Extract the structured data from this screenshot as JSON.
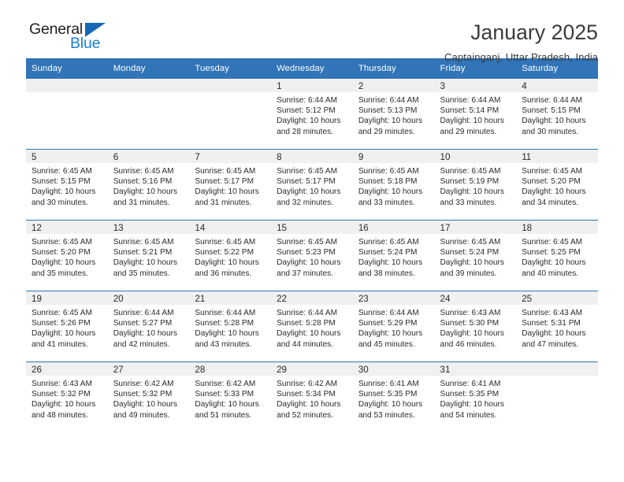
{
  "brand": {
    "name_top": "General",
    "name_bottom": "Blue",
    "triangle_color": "#1668b3",
    "blue_color": "#1c7fd4"
  },
  "header": {
    "title": "January 2025",
    "subtitle": "Captainganj, Uttar Pradesh, India"
  },
  "theme": {
    "header_bg": "#3174b8",
    "daynum_bg": "#f0f0f0",
    "text": "#2b2b2b"
  },
  "weekday_headers": [
    "Sunday",
    "Monday",
    "Tuesday",
    "Wednesday",
    "Thursday",
    "Friday",
    "Saturday"
  ],
  "weeks": [
    [
      {
        "day": "",
        "lines": []
      },
      {
        "day": "",
        "lines": []
      },
      {
        "day": "",
        "lines": []
      },
      {
        "day": "1",
        "lines": [
          "Sunrise: 6:44 AM",
          "Sunset: 5:12 PM",
          "Daylight: 10 hours",
          "and 28 minutes."
        ]
      },
      {
        "day": "2",
        "lines": [
          "Sunrise: 6:44 AM",
          "Sunset: 5:13 PM",
          "Daylight: 10 hours",
          "and 29 minutes."
        ]
      },
      {
        "day": "3",
        "lines": [
          "Sunrise: 6:44 AM",
          "Sunset: 5:14 PM",
          "Daylight: 10 hours",
          "and 29 minutes."
        ]
      },
      {
        "day": "4",
        "lines": [
          "Sunrise: 6:44 AM",
          "Sunset: 5:15 PM",
          "Daylight: 10 hours",
          "and 30 minutes."
        ]
      }
    ],
    [
      {
        "day": "5",
        "lines": [
          "Sunrise: 6:45 AM",
          "Sunset: 5:15 PM",
          "Daylight: 10 hours",
          "and 30 minutes."
        ]
      },
      {
        "day": "6",
        "lines": [
          "Sunrise: 6:45 AM",
          "Sunset: 5:16 PM",
          "Daylight: 10 hours",
          "and 31 minutes."
        ]
      },
      {
        "day": "7",
        "lines": [
          "Sunrise: 6:45 AM",
          "Sunset: 5:17 PM",
          "Daylight: 10 hours",
          "and 31 minutes."
        ]
      },
      {
        "day": "8",
        "lines": [
          "Sunrise: 6:45 AM",
          "Sunset: 5:17 PM",
          "Daylight: 10 hours",
          "and 32 minutes."
        ]
      },
      {
        "day": "9",
        "lines": [
          "Sunrise: 6:45 AM",
          "Sunset: 5:18 PM",
          "Daylight: 10 hours",
          "and 33 minutes."
        ]
      },
      {
        "day": "10",
        "lines": [
          "Sunrise: 6:45 AM",
          "Sunset: 5:19 PM",
          "Daylight: 10 hours",
          "and 33 minutes."
        ]
      },
      {
        "day": "11",
        "lines": [
          "Sunrise: 6:45 AM",
          "Sunset: 5:20 PM",
          "Daylight: 10 hours",
          "and 34 minutes."
        ]
      }
    ],
    [
      {
        "day": "12",
        "lines": [
          "Sunrise: 6:45 AM",
          "Sunset: 5:20 PM",
          "Daylight: 10 hours",
          "and 35 minutes."
        ]
      },
      {
        "day": "13",
        "lines": [
          "Sunrise: 6:45 AM",
          "Sunset: 5:21 PM",
          "Daylight: 10 hours",
          "and 35 minutes."
        ]
      },
      {
        "day": "14",
        "lines": [
          "Sunrise: 6:45 AM",
          "Sunset: 5:22 PM",
          "Daylight: 10 hours",
          "and 36 minutes."
        ]
      },
      {
        "day": "15",
        "lines": [
          "Sunrise: 6:45 AM",
          "Sunset: 5:23 PM",
          "Daylight: 10 hours",
          "and 37 minutes."
        ]
      },
      {
        "day": "16",
        "lines": [
          "Sunrise: 6:45 AM",
          "Sunset: 5:24 PM",
          "Daylight: 10 hours",
          "and 38 minutes."
        ]
      },
      {
        "day": "17",
        "lines": [
          "Sunrise: 6:45 AM",
          "Sunset: 5:24 PM",
          "Daylight: 10 hours",
          "and 39 minutes."
        ]
      },
      {
        "day": "18",
        "lines": [
          "Sunrise: 6:45 AM",
          "Sunset: 5:25 PM",
          "Daylight: 10 hours",
          "and 40 minutes."
        ]
      }
    ],
    [
      {
        "day": "19",
        "lines": [
          "Sunrise: 6:45 AM",
          "Sunset: 5:26 PM",
          "Daylight: 10 hours",
          "and 41 minutes."
        ]
      },
      {
        "day": "20",
        "lines": [
          "Sunrise: 6:44 AM",
          "Sunset: 5:27 PM",
          "Daylight: 10 hours",
          "and 42 minutes."
        ]
      },
      {
        "day": "21",
        "lines": [
          "Sunrise: 6:44 AM",
          "Sunset: 5:28 PM",
          "Daylight: 10 hours",
          "and 43 minutes."
        ]
      },
      {
        "day": "22",
        "lines": [
          "Sunrise: 6:44 AM",
          "Sunset: 5:28 PM",
          "Daylight: 10 hours",
          "and 44 minutes."
        ]
      },
      {
        "day": "23",
        "lines": [
          "Sunrise: 6:44 AM",
          "Sunset: 5:29 PM",
          "Daylight: 10 hours",
          "and 45 minutes."
        ]
      },
      {
        "day": "24",
        "lines": [
          "Sunrise: 6:43 AM",
          "Sunset: 5:30 PM",
          "Daylight: 10 hours",
          "and 46 minutes."
        ]
      },
      {
        "day": "25",
        "lines": [
          "Sunrise: 6:43 AM",
          "Sunset: 5:31 PM",
          "Daylight: 10 hours",
          "and 47 minutes."
        ]
      }
    ],
    [
      {
        "day": "26",
        "lines": [
          "Sunrise: 6:43 AM",
          "Sunset: 5:32 PM",
          "Daylight: 10 hours",
          "and 48 minutes."
        ]
      },
      {
        "day": "27",
        "lines": [
          "Sunrise: 6:42 AM",
          "Sunset: 5:32 PM",
          "Daylight: 10 hours",
          "and 49 minutes."
        ]
      },
      {
        "day": "28",
        "lines": [
          "Sunrise: 6:42 AM",
          "Sunset: 5:33 PM",
          "Daylight: 10 hours",
          "and 51 minutes."
        ]
      },
      {
        "day": "29",
        "lines": [
          "Sunrise: 6:42 AM",
          "Sunset: 5:34 PM",
          "Daylight: 10 hours",
          "and 52 minutes."
        ]
      },
      {
        "day": "30",
        "lines": [
          "Sunrise: 6:41 AM",
          "Sunset: 5:35 PM",
          "Daylight: 10 hours",
          "and 53 minutes."
        ]
      },
      {
        "day": "31",
        "lines": [
          "Sunrise: 6:41 AM",
          "Sunset: 5:35 PM",
          "Daylight: 10 hours",
          "and 54 minutes."
        ]
      },
      {
        "day": "",
        "lines": []
      }
    ]
  ]
}
